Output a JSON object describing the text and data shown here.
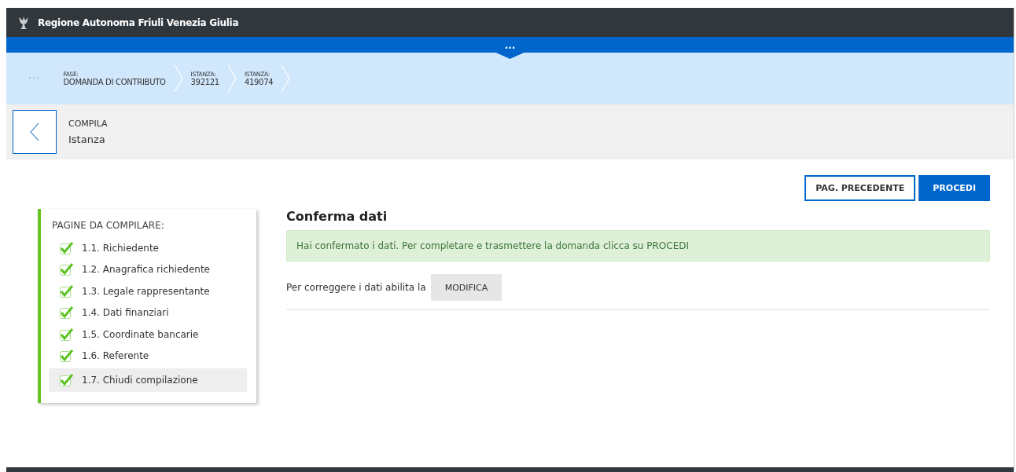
{
  "header": {
    "title": "Regione Autonoma Friuli Venezia Giulia"
  },
  "blue_bar": {
    "toggle": "···"
  },
  "breadcrumb": {
    "more": "···",
    "items": [
      {
        "label": "FASE:",
        "value": "DOMANDA DI CONTRIBUTO"
      },
      {
        "label": "ISTANZA:",
        "value": "392121"
      },
      {
        "label": "ISTANZA:",
        "value": "419074"
      }
    ]
  },
  "page_header": {
    "kicker": "COMPILA",
    "title": "Istanza"
  },
  "actions": [
    "PAG. PRECEDENTE",
    "PROCEDI"
  ],
  "sidebar": {
    "title": "PAGINE DA COMPILARE:",
    "items": [
      {
        "label": "1.1. Richiedente",
        "checked": true,
        "selected": false
      },
      {
        "label": "1.2. Anagrafica richiedente",
        "checked": true,
        "selected": false
      },
      {
        "label": "1.3. Legale rappresentante",
        "checked": true,
        "selected": false
      },
      {
        "label": "1.4. Dati finanziari",
        "checked": true,
        "selected": false
      },
      {
        "label": "1.5. Coordinate bancarie",
        "checked": true,
        "selected": false
      },
      {
        "label": "1.6. Referente",
        "checked": true,
        "selected": false
      },
      {
        "label": "1.7. Chiudi compilazione",
        "checked": true,
        "selected": true
      }
    ]
  },
  "main": {
    "title": "Conferma dati",
    "alert": "Hai confermato i dati. Per completare e trasmettere la domanda clicca su PROCEDI",
    "edit_text": "Per correggere i dati abilita la",
    "edit_button": "MODIFICA"
  }
}
